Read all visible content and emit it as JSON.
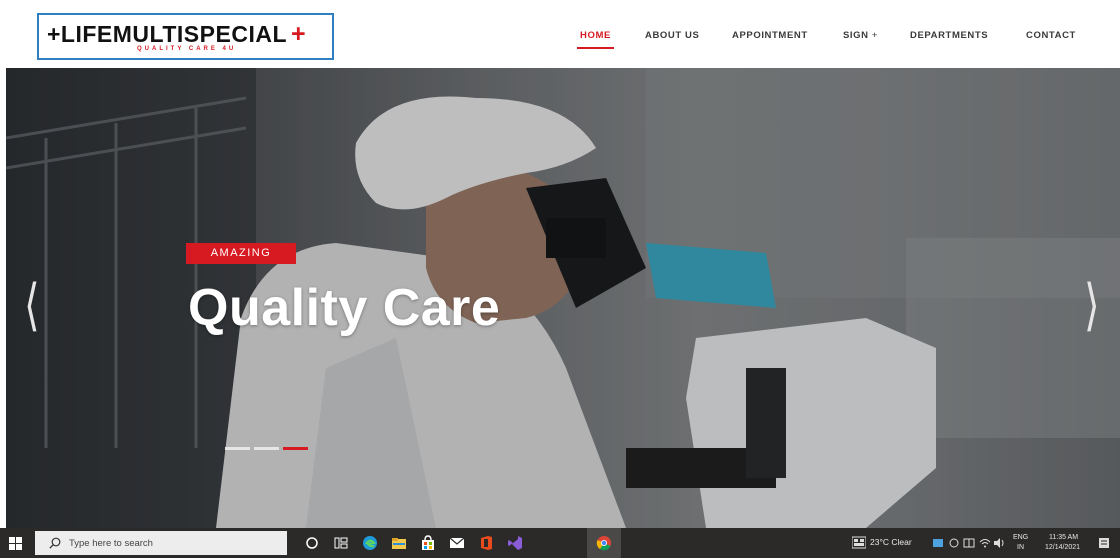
{
  "header": {
    "logo_main": "+LIFEMULTISPECIAL",
    "logo_cross": "+",
    "logo_tagline": "QUALITY CARE 4U",
    "nav": [
      {
        "label": "HOME"
      },
      {
        "label": "ABOUT US"
      },
      {
        "label": "APPOINTMENT"
      },
      {
        "label": "SIGN"
      },
      {
        "label": "DEPARTMENTS"
      },
      {
        "label": "CONTACT"
      }
    ],
    "dropdown_marker": "+"
  },
  "hero": {
    "badge": "AMAZING",
    "title": "Quality Care",
    "prev_arrow": "⟨",
    "next_arrow": "⟩",
    "slides_total": 3,
    "active_slide": 3
  },
  "taskbar": {
    "search_placeholder": "Type here to search",
    "weather": "23°C Clear",
    "language_top": "ENG",
    "language_bottom": "IN",
    "time": "11:35 AM",
    "date": "12/14/2021",
    "apps": [
      "task-view",
      "edge",
      "file-explorer",
      "microsoft-store",
      "mail",
      "office",
      "visual-studio",
      "chrome"
    ]
  },
  "colors": {
    "accent_red": "#d71a21",
    "logo_border": "#2f7fc1",
    "taskbar": "#2b2a29"
  }
}
